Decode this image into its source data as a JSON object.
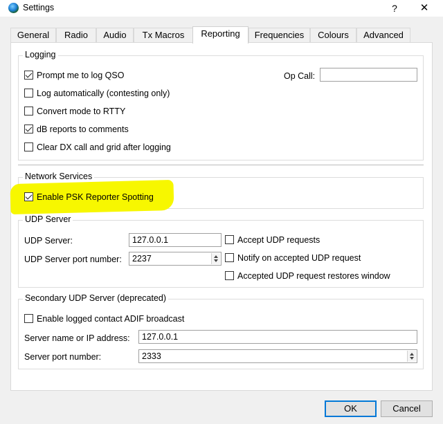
{
  "window": {
    "title": "Settings",
    "help_glyph": "?",
    "close_glyph": "✕"
  },
  "tabs": [
    "General",
    "Radio",
    "Audio",
    "Tx Macros",
    "Reporting",
    "Frequencies",
    "Colours",
    "Advanced"
  ],
  "active_tab": "Reporting",
  "logging": {
    "title": "Logging",
    "prompt_log_qso": {
      "label": "Prompt me to log QSO",
      "checked": true
    },
    "log_automatically": {
      "label": "Log automatically (contesting only)",
      "checked": false
    },
    "convert_mode_rtty": {
      "label": "Convert mode to RTTY",
      "checked": false
    },
    "db_reports_comments": {
      "label": "dB reports to comments",
      "checked": true
    },
    "clear_dx_call": {
      "label": "Clear DX call and grid after logging",
      "checked": false
    },
    "op_call_label": "Op Call:",
    "op_call_value": ""
  },
  "network": {
    "title": "Network Services",
    "enable_psk": {
      "label": "Enable PSK Reporter Spotting",
      "checked": true
    }
  },
  "udp": {
    "title": "UDP Server",
    "server_label": "UDP Server:",
    "server_value": "127.0.0.1",
    "port_label": "UDP Server port number:",
    "port_value": "2237",
    "accept_requests": {
      "label": "Accept UDP requests",
      "checked": false
    },
    "notify_accepted": {
      "label": "Notify on accepted UDP request",
      "checked": false
    },
    "restores_window": {
      "label": "Accepted UDP request restores window",
      "checked": false
    }
  },
  "secondary_udp": {
    "title": "Secondary UDP Server (deprecated)",
    "enable_adif": {
      "label": "Enable logged contact ADIF broadcast",
      "checked": false
    },
    "server_name_label": "Server name or IP address:",
    "server_name_value": "127.0.0.1",
    "port_label": "Server port number:",
    "port_value": "2333"
  },
  "buttons": {
    "ok": "OK",
    "cancel": "Cancel"
  },
  "colors": {
    "highlight": "#f7f700",
    "accent": "#0078d7"
  }
}
